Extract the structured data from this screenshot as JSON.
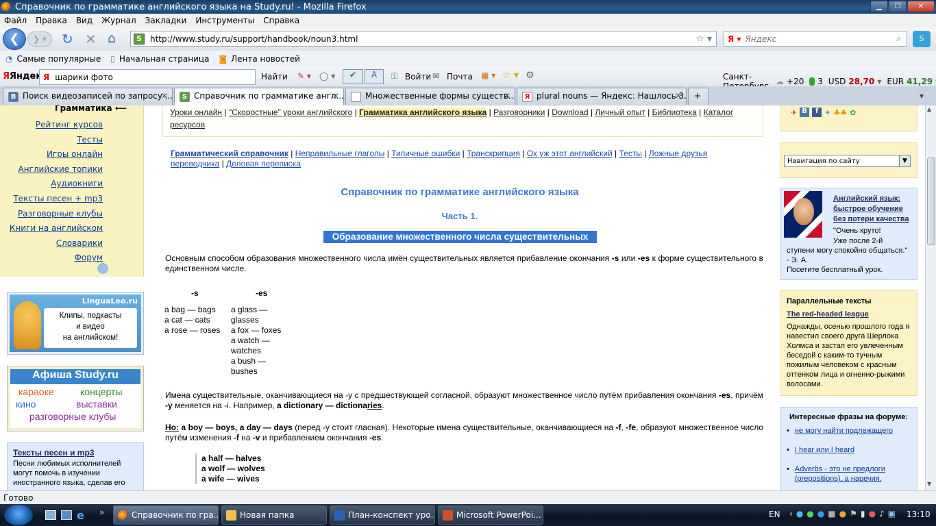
{
  "window": {
    "title": "Справочник по грамматике английского языка на Study.ru! - Mozilla Firefox"
  },
  "menu": [
    "Файл",
    "Правка",
    "Вид",
    "Журнал",
    "Закладки",
    "Инструменты",
    "Справка"
  ],
  "nav": {
    "url": "http://www.study.ru/support/handbook/noun3.html",
    "search_placeholder": "Яндекс"
  },
  "bookmarks": [
    "Самые популярные",
    "Начальная страница",
    "Лента новостей"
  ],
  "yandex_bar": {
    "brand": "Яндекс",
    "query": "шарики фото",
    "find": "Найти",
    "login": "Войти",
    "mail": "Почта",
    "city": "Санкт-Петербург",
    "temp": "+20",
    "traffic": "3",
    "usd_label": "USD",
    "usd": "28,70",
    "eur_label": "EUR",
    "eur": "41,29"
  },
  "tabs": [
    {
      "label": "Поиск видеозаписей по запросу ...",
      "icon": "B"
    },
    {
      "label": "Справочник по грамматике англ...",
      "icon": "S"
    },
    {
      "label": "Множественные формы существ...",
      "icon": ""
    },
    {
      "label": "plural nouns — Яндекс: Нашлось 3...",
      "icon": "Я"
    }
  ],
  "left": {
    "heading": "Грамматика",
    "menu": [
      "Рейтинг курсов",
      "Тесты",
      "Игры онлайн",
      "Английские топики",
      "Аудиокниги",
      "Тексты песен + mp3",
      "Разговорные клубы",
      "Книги на английском",
      "Словарики",
      "Форум"
    ],
    "lingualeo": {
      "brand": "LinguaLeo.ru",
      "line1": "Клипы, подкасты",
      "line2": "и видео",
      "line3": "на английском!"
    },
    "afisha": {
      "title": "Афиша Study.ru",
      "w1": "караоке",
      "w2": "концерты",
      "w3": "кино",
      "w4": "выставки",
      "w5": "разговорные клубы"
    },
    "songs": {
      "title": "Тексты песен и mp3",
      "text": "Песни любимых исполнителей могут помочь в изучении иностранного языка, сделав его"
    }
  },
  "center": {
    "topnav": [
      "Уроки онлайн",
      "\"Скоростные\" уроки английского",
      "Грамматика английского языка",
      "Разговорники",
      "Download",
      "Личный опыт",
      "Библиотека",
      "Каталог ресурсов"
    ],
    "subnav": [
      "Грамматический справочник",
      "Неправильные глаголы",
      "Типичные ошибки",
      "Транскрипция",
      "Ох уж этот английский",
      "Тесты",
      "Ложные друзья переводчика",
      "Деловая переписка"
    ],
    "title": "Справочник по грамматике английского языка",
    "part": "Часть 1.",
    "section": "Образование множественного числа существительных",
    "intro_a": "Основным способом образования множественного числа имён существительных является прибавление окончания ",
    "intro_s": "-s",
    "intro_or": " или ",
    "intro_es": "-es",
    "intro_b": " к форме существительного в единственном числе.",
    "col_s": "-s",
    "col_es": "-es",
    "examples_s": [
      "a bag — bags",
      "a cat — cats",
      "a rose — roses"
    ],
    "examples_es": [
      "a glass —",
      "glasses",
      "a fox — foxes",
      "a watch —",
      "watches",
      "a bush —",
      "bushes"
    ],
    "y_a": "Имена существительные, оканчивающиеся на -y с предшествующей согласной, образуют множественное число путём прибавления окончания ",
    "y_es": "-es",
    "y_b": ", причём ",
    "y_y": "-y",
    "y_c": " меняется на -i. Например, ",
    "y_ex": "a dictionary — dictiona",
    "y_ex_u": "ries",
    "y_end": ".",
    "no_label": "Но:",
    "no_ex": " a boy — boys, a day — days",
    "no_a": " (перед -y стоит гласная). Некоторые имена существительные, оканчивающиеся на ",
    "no_f": "-f",
    "no_comma": ", ",
    "no_fe": "-fe",
    "no_b": ", образуют множественное число путём изменения ",
    "no_f2": "-f",
    "no_c": " на ",
    "no_v": "-v",
    "no_d": " и прибавлением окончания ",
    "no_es": "-es",
    "no_end": ".",
    "f_examples": [
      "a half — halves",
      "a wolf — wolves",
      "a wife — wives"
    ]
  },
  "right": {
    "nav_select": "Навигация по сайту",
    "promo": {
      "title": "Английский язык: быстрое обучение без потери качества",
      "quote1": "\"Очень круто!",
      "quote2": "Уже после 2-й",
      "quote3": "ступени могу спокойно общаться.\"",
      "author": "- Э. А.",
      "cta": "Посетите бесплатный урок."
    },
    "parallel": {
      "heading": "Параллельные тексты",
      "link": "The red-headed league",
      "text": "Однажды, осенью прошлого года я навестил своего друга Шерлока Холмса и застал его увлеченным беседой с каким-то тучным пожилым человеком с красным оттенком лица и огненно-рыжими волосами."
    },
    "forum": {
      "heading": "Интересные фразы на форуме:",
      "items": [
        "не могу найти подлежащего",
        "I hear или I heard",
        "Adverbs - это не предлоги (prepositions), а наречия."
      ]
    }
  },
  "status": "Готово",
  "taskbar": {
    "tasks": [
      "Справочник по гра...",
      "Новая папка",
      "План-конспект уро...",
      "Microsoft PowerPoi..."
    ],
    "lang": "EN",
    "clock": "13:10"
  }
}
